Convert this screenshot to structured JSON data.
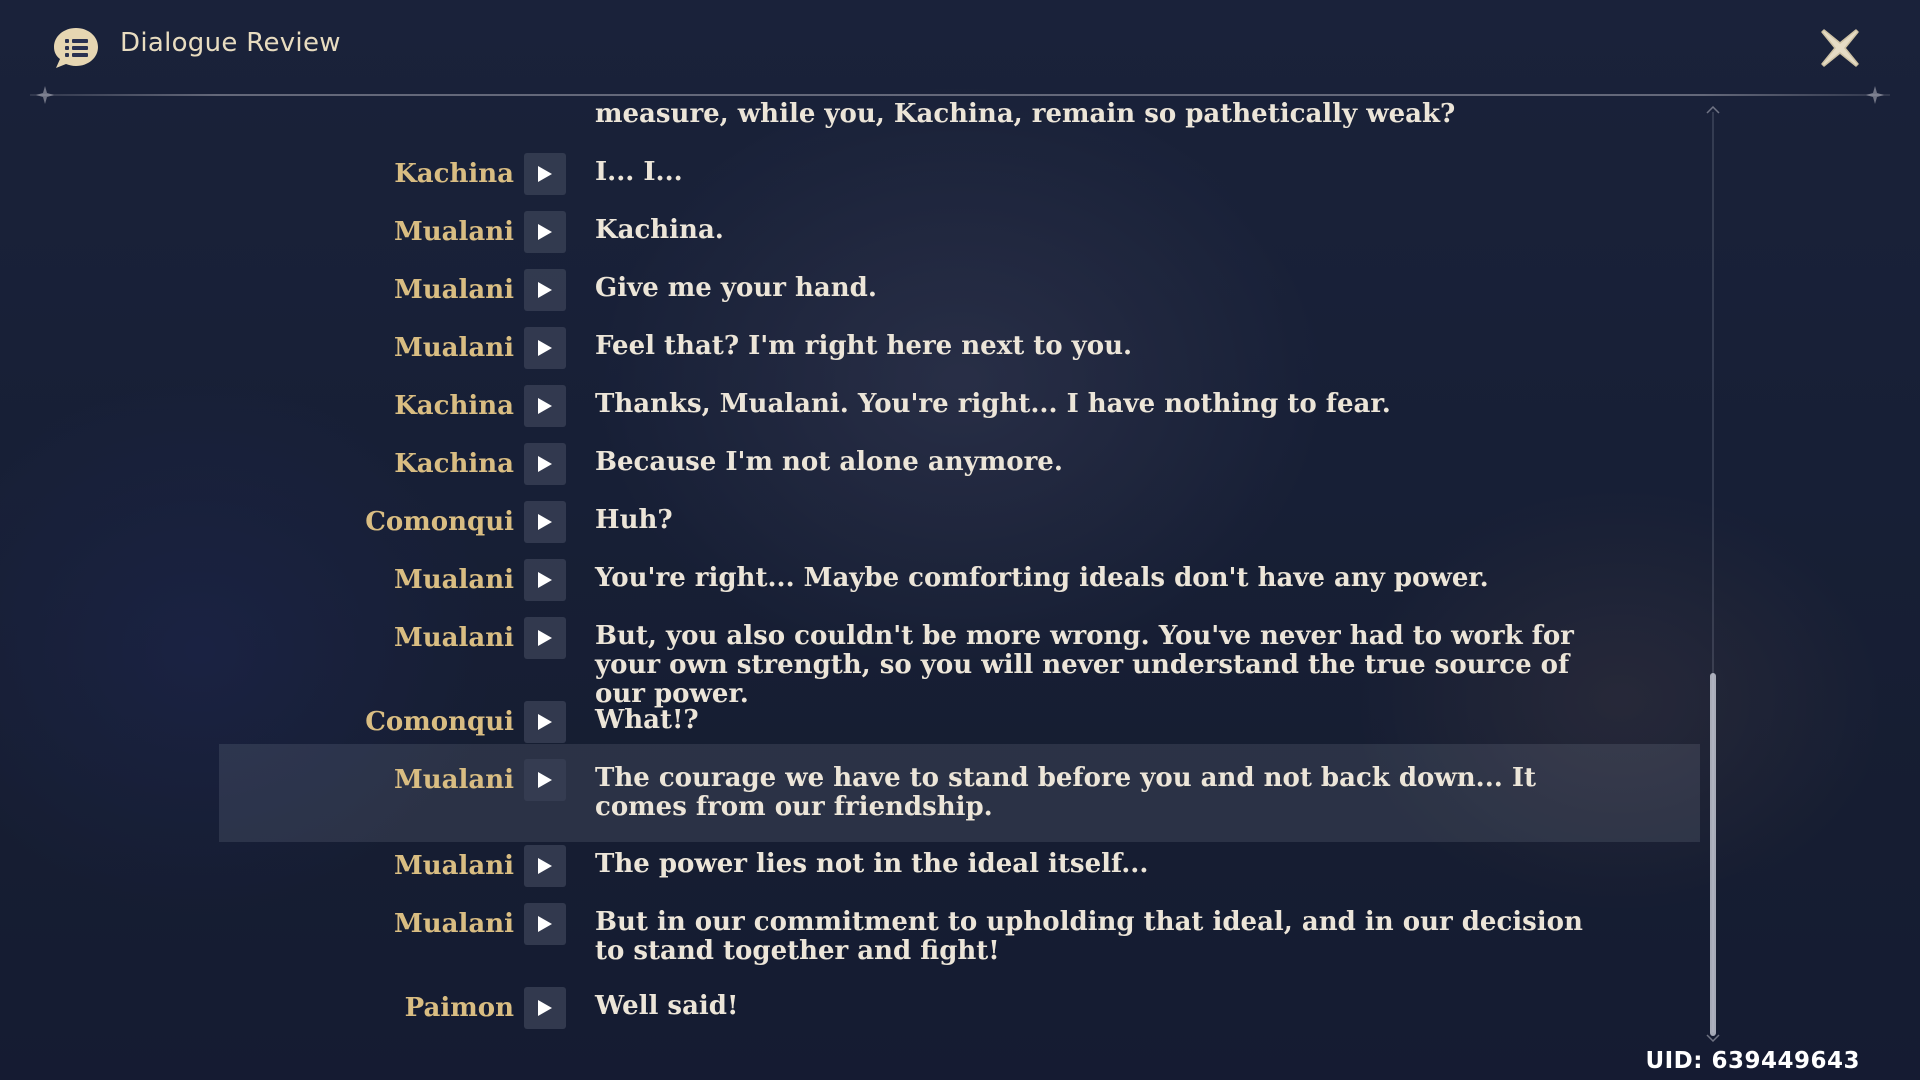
{
  "header": {
    "icon": "speech-list-icon",
    "title": "Dialogue Review",
    "close_icon": "close-icon"
  },
  "dialogue": [
    {
      "speaker": "",
      "text": "measure, while you, Kachina, remain so pathetically weak?"
    },
    {
      "speaker": "Kachina",
      "text": "I... I..."
    },
    {
      "speaker": "Mualani",
      "text": "Kachina."
    },
    {
      "speaker": "Mualani",
      "text": "Give me your hand."
    },
    {
      "speaker": "Mualani",
      "text": "Feel that? I'm right here next to you."
    },
    {
      "speaker": "Kachina",
      "text": "Thanks, Mualani. You're right... I have nothing to fear."
    },
    {
      "speaker": "Kachina",
      "text": "Because I'm not alone anymore."
    },
    {
      "speaker": "Comonqui",
      "text": "Huh?"
    },
    {
      "speaker": "Mualani",
      "text": "You're right... Maybe comforting ideals don't have any power."
    },
    {
      "speaker": "Mualani",
      "text": "But, you also couldn't be more wrong. You've never had to work for your own strength, so you will never understand the true source of our power."
    },
    {
      "speaker": "Comonqui",
      "text": "What!?"
    },
    {
      "speaker": "Mualani",
      "text": "The courage we have to stand before you and not back down... It comes from our friendship.",
      "highlighted": true
    },
    {
      "speaker": "Mualani",
      "text": "The power lies not in the ideal itself..."
    },
    {
      "speaker": "Mualani",
      "text": "But in our commitment to upholding that ideal, and in our decision to stand together and fight!"
    },
    {
      "speaker": "Paimon",
      "text": "Well said!"
    }
  ],
  "play_icon": "play-icon",
  "uid": "UID: 639449643",
  "colors": {
    "speaker": "#d9bd82",
    "text": "#ece5d8",
    "header_title": "#e8dcc0",
    "highlight": "rgba(200,205,225,0.12)"
  }
}
